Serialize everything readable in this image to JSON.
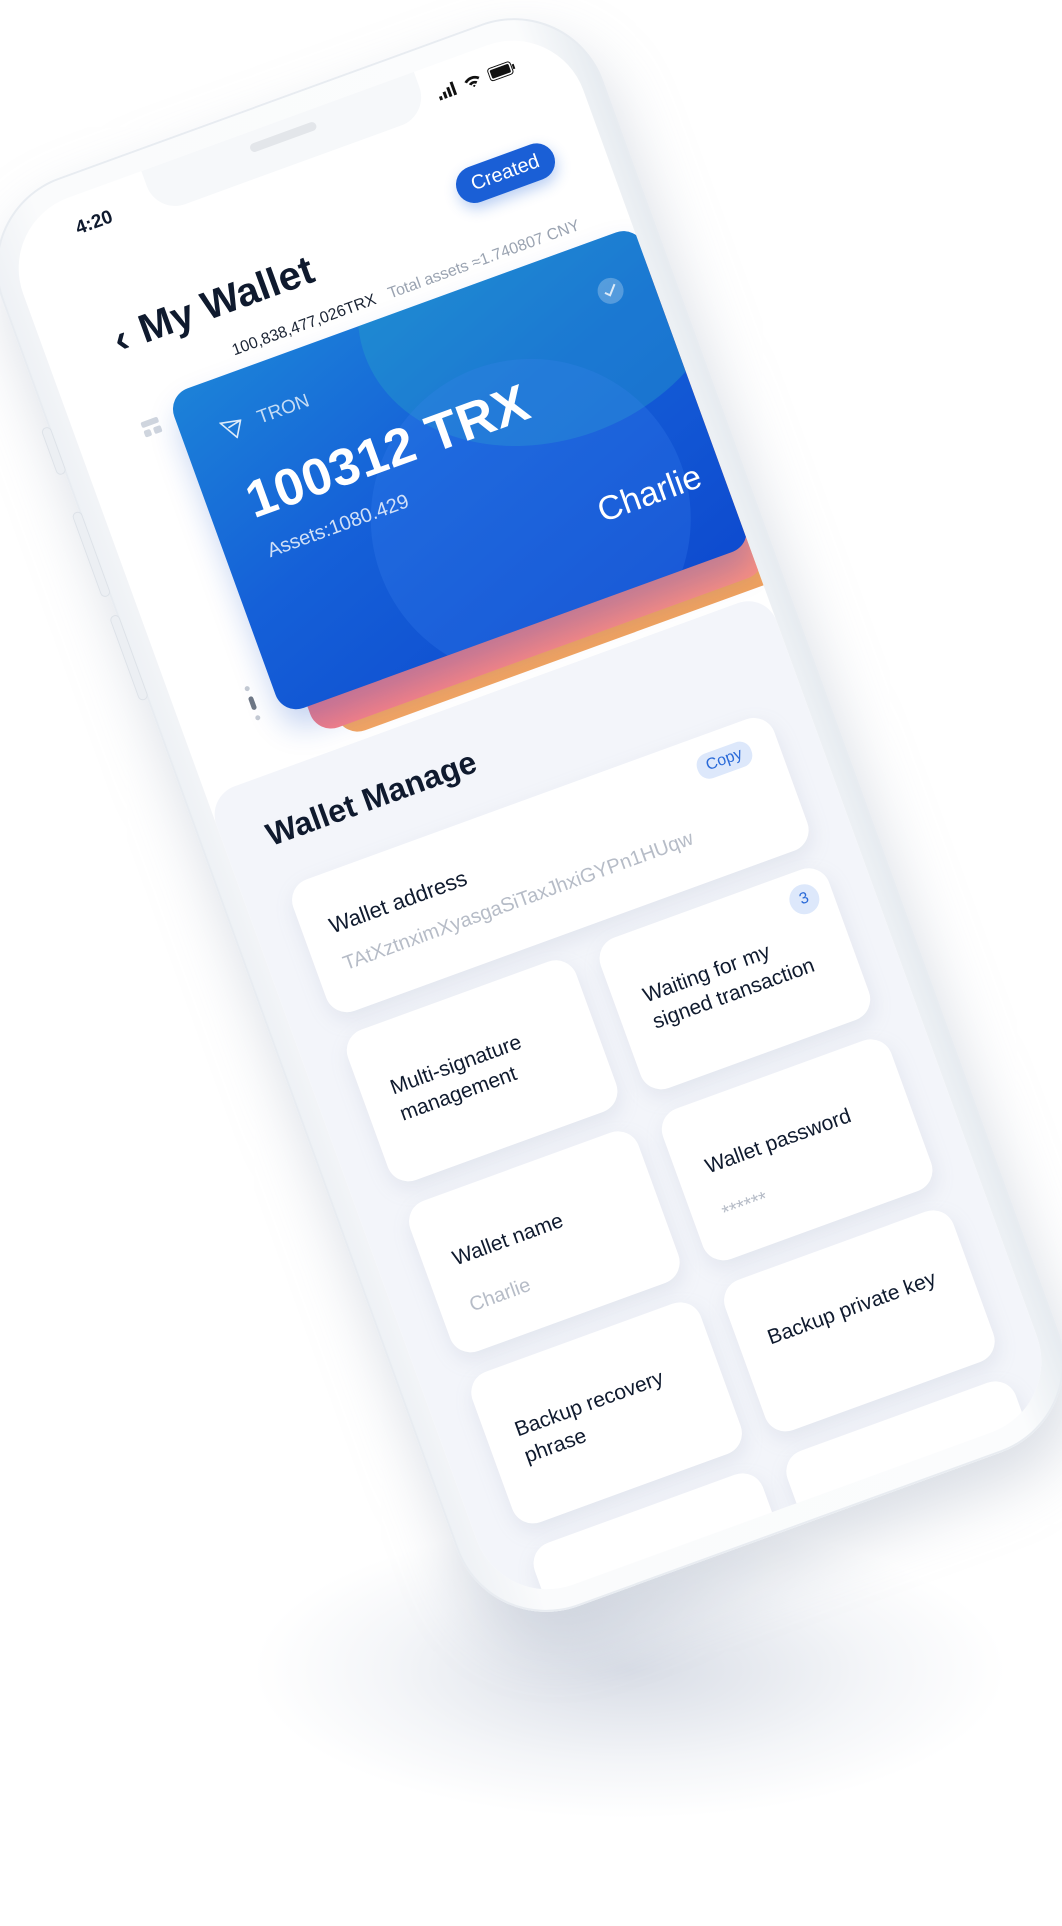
{
  "status_bar": {
    "time": "4:20",
    "icons": [
      "signal-icon",
      "wifi-icon",
      "battery-icon"
    ]
  },
  "header": {
    "back_icon": "chevron-left-icon",
    "title": "My Wallet",
    "created_label": "Created",
    "total_trx": "100,838,477,026TRX",
    "total_assets": "Total assets ≈1.740807 CNY"
  },
  "wallet_card": {
    "network": "TRON",
    "balance": "100312 TRX",
    "assets": "Assets:1080.429",
    "name": "Charlie",
    "colors": {
      "primary": "#1560d8",
      "stack_pink": "#f7738a",
      "stack_orange": "#f5a766"
    }
  },
  "manage": {
    "title": "Wallet Manage",
    "address": {
      "label": "Wallet address",
      "value": "TAtXztnximXyasgaSiTaxJhxiGYPn1HUqw",
      "copy_label": "Copy"
    },
    "tiles": [
      {
        "label": "Multi-signature management"
      },
      {
        "label": "Waiting for my signed transaction",
        "badge": "3"
      },
      {
        "label": "Wallet name",
        "value": "Charlie"
      },
      {
        "label": "Wallet password",
        "value": "******"
      },
      {
        "label": "Backup recovery phrase"
      },
      {
        "label": "Backup private key"
      }
    ]
  },
  "colors": {
    "accent": "#1a5fd6",
    "badge_bg": "#dde8fb",
    "muted_text": "#b6bcc7"
  }
}
